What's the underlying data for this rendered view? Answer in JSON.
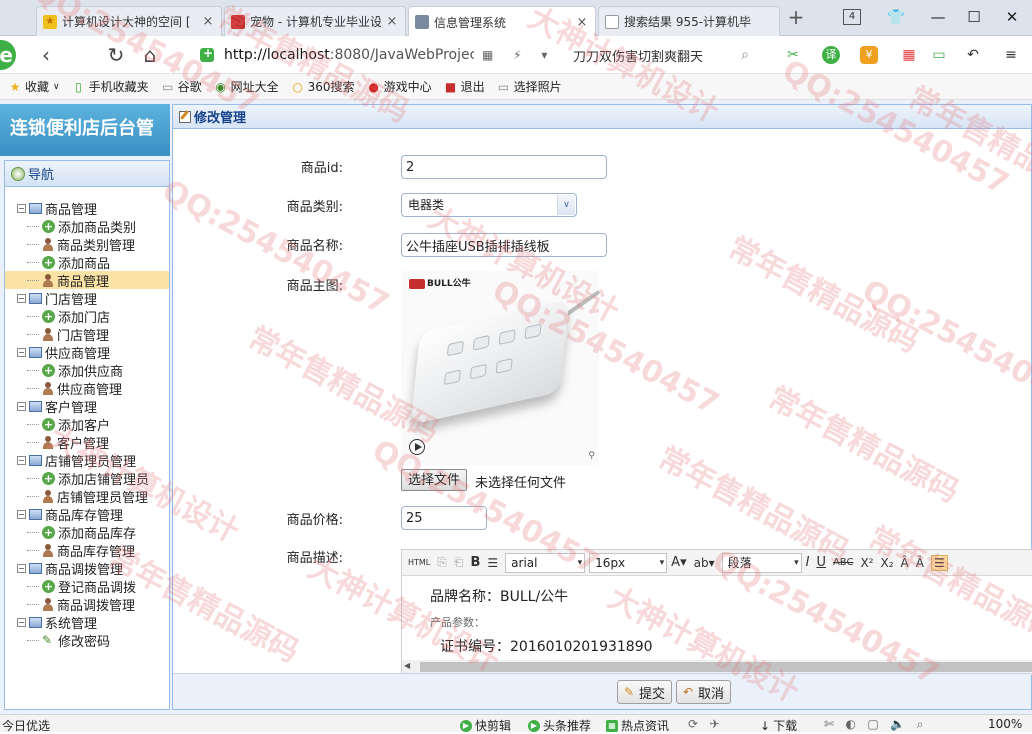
{
  "browser": {
    "tabs": [
      {
        "title": "计算机设计大神的空间 [",
        "close": "×"
      },
      {
        "title": "宠物 - 计算机专业毕业设",
        "close": "×"
      },
      {
        "title": "信息管理系统",
        "close": "×"
      },
      {
        "title": "搜索结果 955-计算机毕",
        "close": ""
      }
    ],
    "new_tab": "+",
    "tab_count": "4",
    "url_host": "http://localhost",
    "url_rest": ":8080/JavaWebProjec",
    "hot_search": "刀刀双伤害切割爽翻天"
  },
  "bookmarks": [
    {
      "label": "收藏",
      "icon": "★"
    },
    {
      "label": "手机收藏夹",
      "icon": "▯"
    },
    {
      "label": "谷歌",
      "icon": "▭"
    },
    {
      "label": "网址大全",
      "icon": "◉"
    },
    {
      "label": "360搜索",
      "icon": "○"
    },
    {
      "label": "游戏中心",
      "icon": "●"
    },
    {
      "label": "退出",
      "icon": "■"
    },
    {
      "label": "选择照片",
      "icon": "▭"
    }
  ],
  "app": {
    "system_title": "连锁便利店后台管",
    "nav_title": "导航",
    "tree": [
      {
        "type": "group",
        "label": "商品管理"
      },
      {
        "type": "add",
        "label": "添加商品类别"
      },
      {
        "type": "manage",
        "label": "商品类别管理"
      },
      {
        "type": "add",
        "label": "添加商品"
      },
      {
        "type": "manage",
        "label": "商品管理",
        "selected": true
      },
      {
        "type": "group",
        "label": "门店管理"
      },
      {
        "type": "add",
        "label": "添加门店"
      },
      {
        "type": "manage",
        "label": "门店管理"
      },
      {
        "type": "group",
        "label": "供应商管理"
      },
      {
        "type": "add",
        "label": "添加供应商"
      },
      {
        "type": "manage",
        "label": "供应商管理"
      },
      {
        "type": "group",
        "label": "客户管理"
      },
      {
        "type": "add",
        "label": "添加客户"
      },
      {
        "type": "manage",
        "label": "客户管理"
      },
      {
        "type": "group",
        "label": "店铺管理员管理"
      },
      {
        "type": "add",
        "label": "添加店铺管理员"
      },
      {
        "type": "manage",
        "label": "店铺管理员管理"
      },
      {
        "type": "group",
        "label": "商品库存管理"
      },
      {
        "type": "add",
        "label": "添加商品库存"
      },
      {
        "type": "manage",
        "label": "商品库存管理"
      },
      {
        "type": "group",
        "label": "商品调拨管理"
      },
      {
        "type": "add",
        "label": "登记商品调拨"
      },
      {
        "type": "manage",
        "label": "商品调拨管理"
      },
      {
        "type": "group",
        "label": "系统管理"
      },
      {
        "type": "pen",
        "label": "修改密码"
      }
    ],
    "panel_title": "修改管理",
    "form": {
      "id_label": "商品id:",
      "id_value": "2",
      "category_label": "商品类别:",
      "category_value": "电器类",
      "name_label": "商品名称:",
      "name_value": "公牛插座USB插排插线板",
      "image_label": "商品主图:",
      "image_brand": "BULL公牛",
      "file_button": "选择文件",
      "file_status": "未选择任何文件",
      "price_label": "商品价格:",
      "price_value": "25",
      "desc_label": "商品描述:"
    },
    "editor": {
      "html_btn": "HTML",
      "font_family": "arial",
      "font_size": "16px",
      "paragraph": "段落",
      "line1": "品牌名称：BULL/公牛",
      "line2": "产品参数：",
      "line3": "证书编号：2016010201931890"
    },
    "buttons": {
      "submit": "提交",
      "cancel": "取消"
    }
  },
  "statusbar": {
    "left": "今日优选",
    "items": [
      "快剪辑",
      "头条推荐",
      "热点资讯",
      "下载"
    ],
    "zoom": "100%"
  },
  "watermark": [
    "常年售精品源码",
    "QQ:254540457",
    "大神计算机设计"
  ]
}
